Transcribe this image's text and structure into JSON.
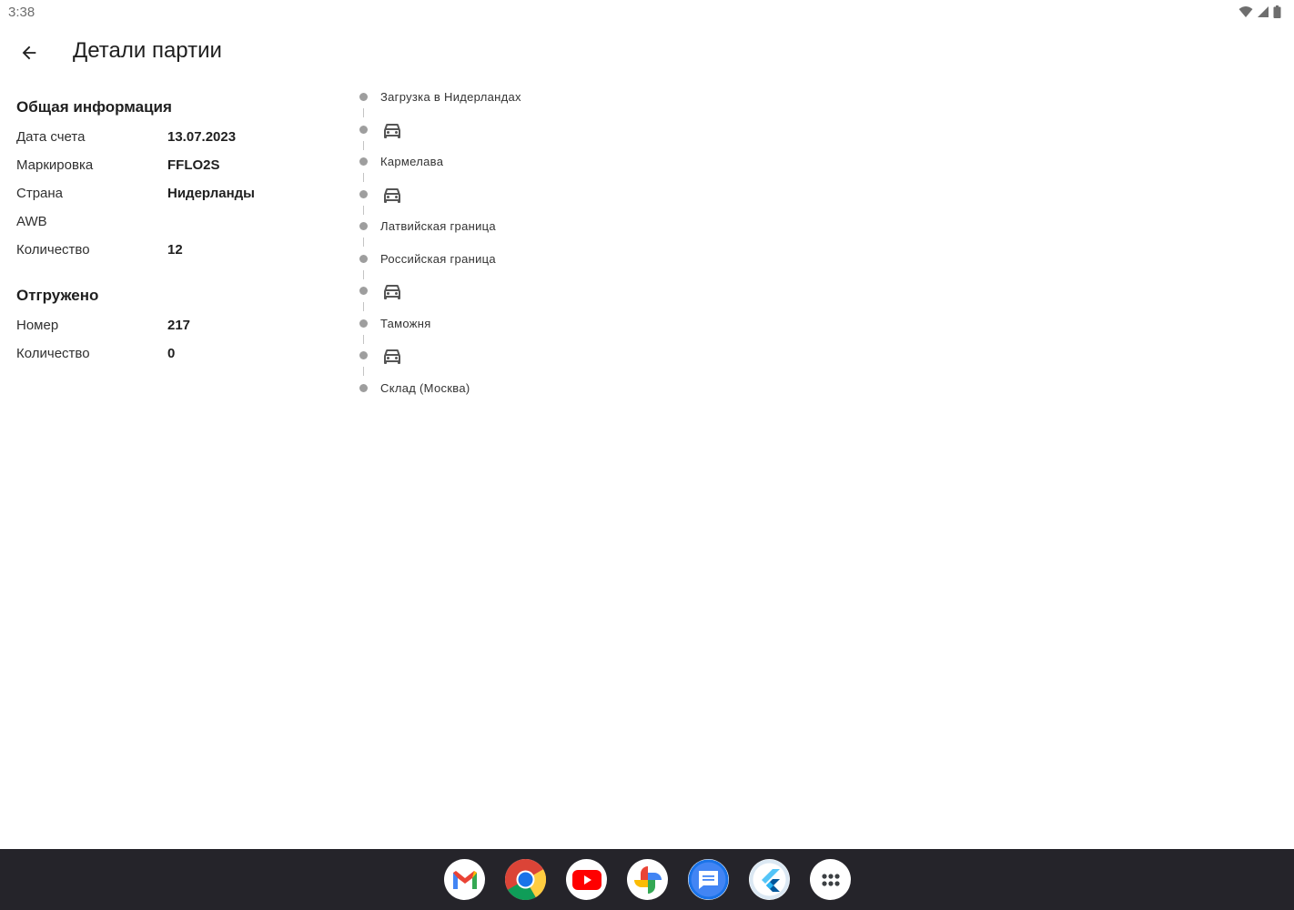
{
  "status_bar": {
    "time": "3:38"
  },
  "app_bar": {
    "title": "Детали партии",
    "back_icon": "arrow-back-icon"
  },
  "general_info": {
    "title": "Общая информация",
    "rows": [
      {
        "label": "Дата счета",
        "value": "13.07.2023"
      },
      {
        "label": "Маркировка",
        "value": "FFLO2S"
      },
      {
        "label": "Страна",
        "value": "Нидерланды"
      },
      {
        "label": "AWB",
        "value": ""
      },
      {
        "label": "Количество",
        "value": "12"
      }
    ]
  },
  "shipped": {
    "title": "Отгружено",
    "rows": [
      {
        "label": "Номер",
        "value": "217"
      },
      {
        "label": "Количество",
        "value": "0"
      }
    ]
  },
  "timeline": {
    "items": [
      {
        "type": "stop",
        "label": "Загрузка в Нидерландах"
      },
      {
        "type": "transit",
        "icon": "car-icon"
      },
      {
        "type": "stop",
        "label": "Кармелава"
      },
      {
        "type": "transit",
        "icon": "car-icon"
      },
      {
        "type": "stop",
        "label": "Латвийская граница"
      },
      {
        "type": "stop",
        "label": "Российская граница"
      },
      {
        "type": "transit",
        "icon": "car-icon"
      },
      {
        "type": "stop",
        "label": "Таможня"
      },
      {
        "type": "transit",
        "icon": "car-icon"
      },
      {
        "type": "stop",
        "label": "Склад (Москва)"
      }
    ]
  },
  "taskbar": {
    "apps": [
      "gmail-icon",
      "chrome-icon",
      "youtube-icon",
      "photos-icon",
      "messages-icon",
      "flutter-icon",
      "app-drawer-icon"
    ]
  },
  "colors": {
    "taskbar_bg": "#25242a",
    "timeline_dot": "#9e9e9e",
    "text_primary": "#1f1f1f"
  }
}
